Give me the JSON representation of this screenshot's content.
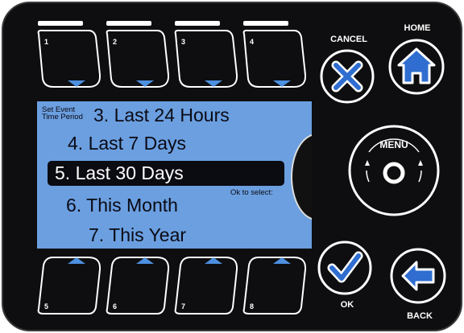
{
  "softkeys_top": [
    "1",
    "2",
    "3",
    "4"
  ],
  "softkeys_bottom": [
    "5",
    "6",
    "7",
    "8"
  ],
  "buttons": {
    "cancel_label": "CANCEL",
    "home_label": "HOME",
    "menu_label": "MENU",
    "ok_label": "OK",
    "back_label": "BACK"
  },
  "screen": {
    "header_line1": "Set Event",
    "header_line2": "Time Period",
    "items": [
      "3. Last 24 Hours",
      "4. Last 7 Days",
      "5. Last 30 Days",
      "6. This Month",
      "7. This Year"
    ],
    "selected_item": "5. Last 30 Days",
    "hint": "Ok to select:"
  },
  "colors": {
    "panel": "#0e0e10",
    "lcd": "#6b9fe0",
    "accent_blue": "#1f5cc4"
  }
}
